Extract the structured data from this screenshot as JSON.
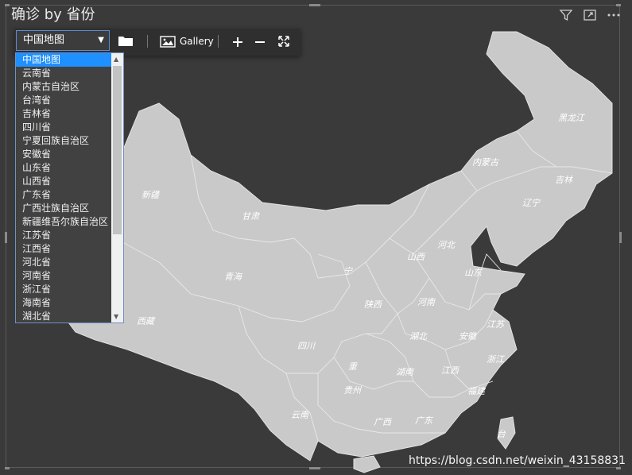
{
  "visual": {
    "title": "确诊 by 省份"
  },
  "toolbar": {
    "selected_map": "中国地图",
    "gallery_label": "Gallery"
  },
  "dropdown": {
    "selected_index": 0,
    "options": [
      "中国地图",
      "云南省",
      "内蒙古自治区",
      "台湾省",
      "吉林省",
      "四川省",
      "宁夏回族自治区",
      "安徽省",
      "山东省",
      "山西省",
      "广东省",
      "广西壮族自治区",
      "新疆维吾尔族自治区",
      "江苏省",
      "江西省",
      "河北省",
      "河南省",
      "浙江省",
      "海南省",
      "湖北省"
    ]
  },
  "map_labels": {
    "xinjiang": "新疆",
    "xizang": "西藏",
    "qinghai": "青海",
    "gansu": "甘肃",
    "neimenggu": "内蒙古",
    "heilongjiang": "黑龙江",
    "jilin": "吉林",
    "liaoning": "辽宁",
    "hebei": "河北",
    "shanxi": "山西",
    "shandong": "山东",
    "henan": "河南",
    "shaanxi": "陕西",
    "ningxia": "宁",
    "sichuan": "四川",
    "chongqing": "重",
    "hubei": "湖北",
    "anhui": "安徽",
    "jiangsu": "江苏",
    "zhejiang": "浙江",
    "hunan": "湖南",
    "jiangxi": "江西",
    "guizhou": "贵州",
    "yunnan": "云南",
    "guangxi": "广西",
    "guangdong": "广东",
    "fujian": "福建",
    "taiwan": "台"
  },
  "watermark": "https://blog.csdn.net/weixin_43158831",
  "colors": {
    "background": "#3a3a3a",
    "map_fill": "#c9c9c9",
    "map_border": "#e4e4e4",
    "selection": "#1e90ff"
  },
  "icons": [
    "filter-icon",
    "focus-mode-icon",
    "more-options-icon",
    "folder-icon",
    "gallery-icon",
    "zoom-in-icon",
    "zoom-out-icon",
    "fit-icon"
  ]
}
